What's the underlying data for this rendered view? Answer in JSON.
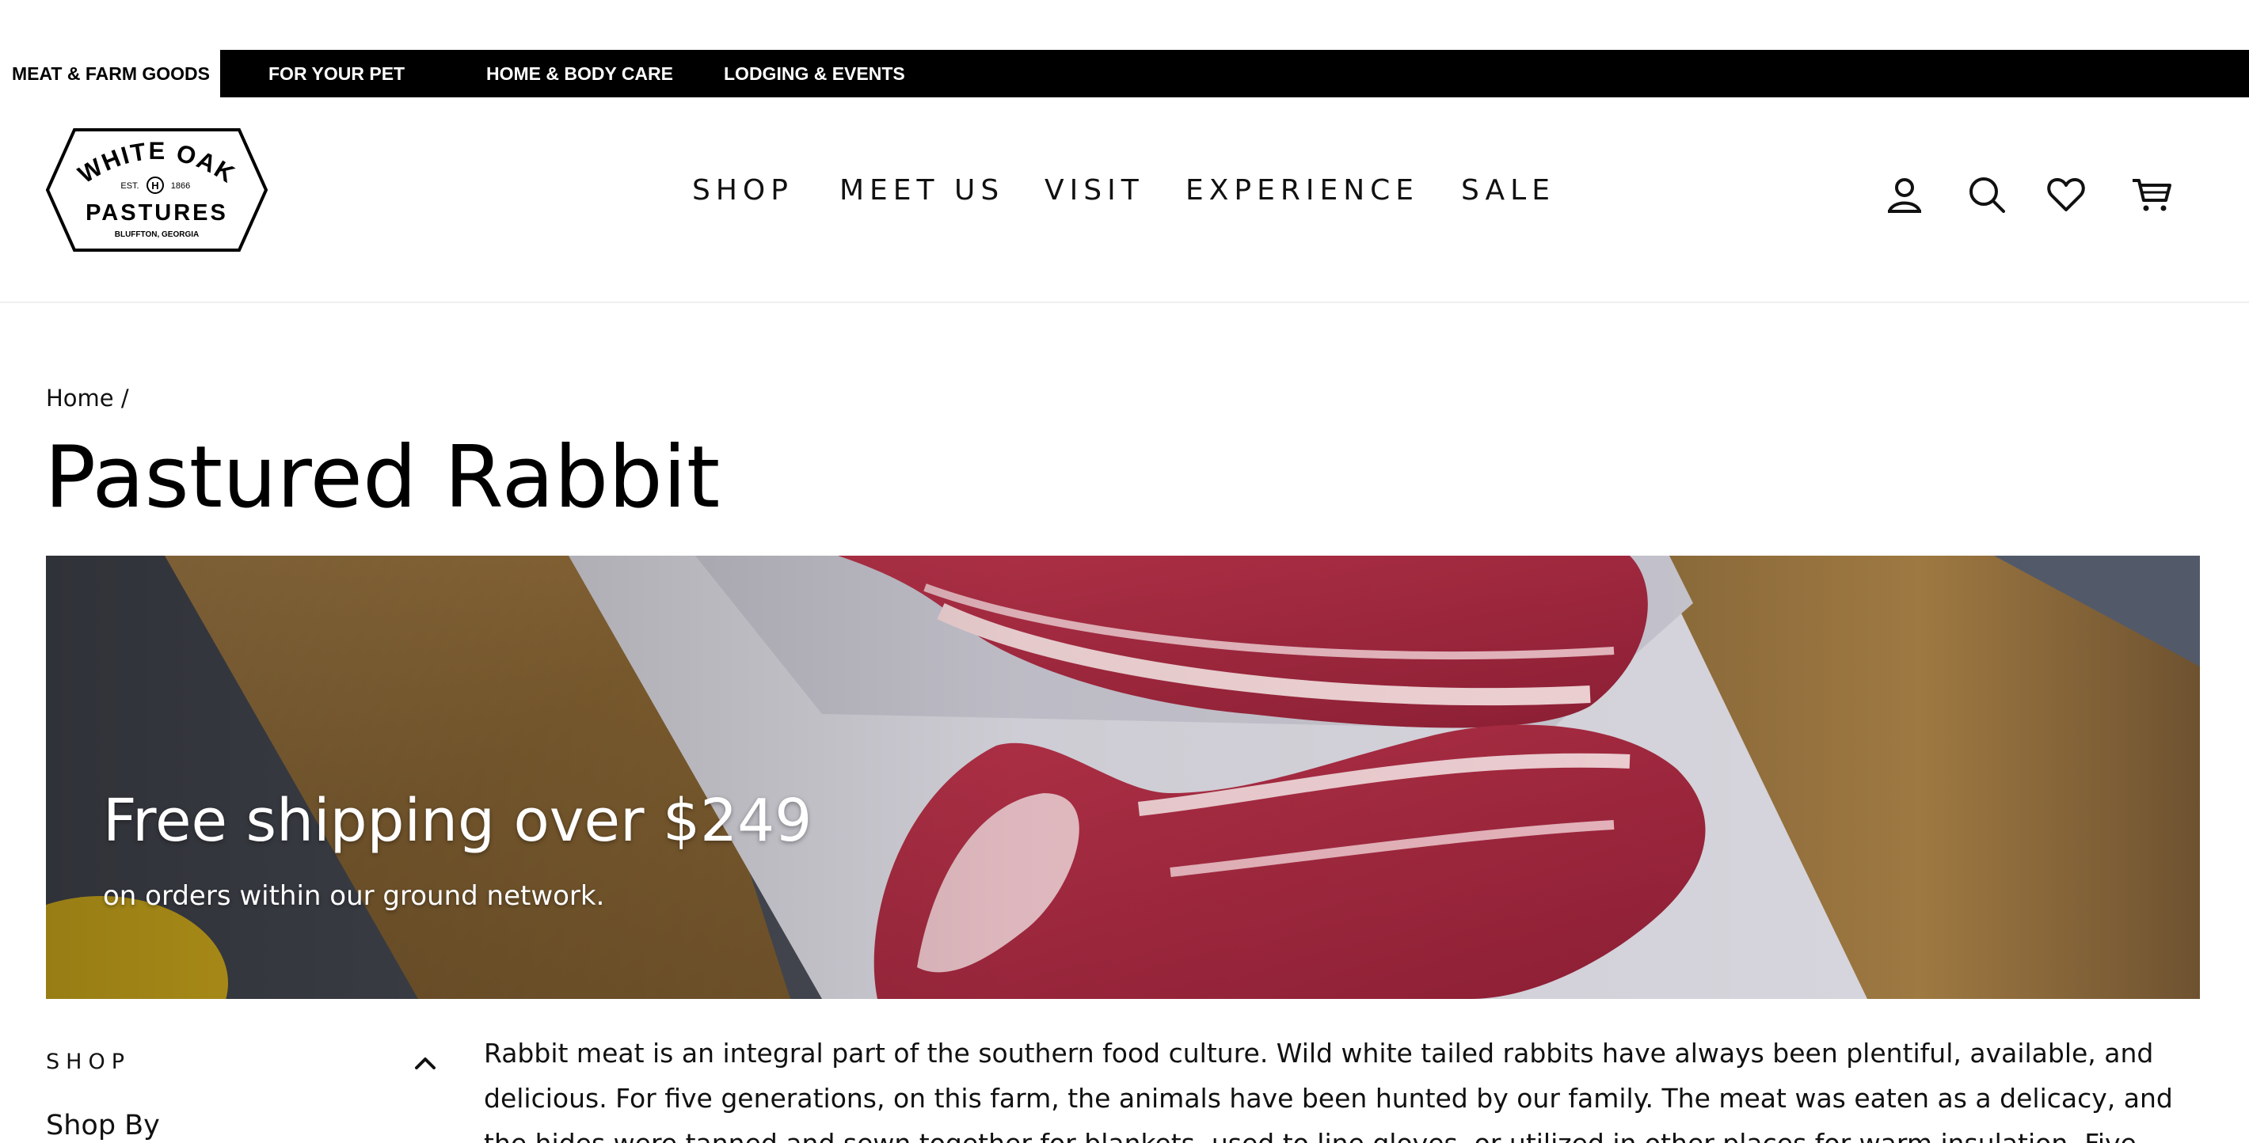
{
  "top_categories": [
    {
      "label": "MEAT & FARM GOODS",
      "active": true
    },
    {
      "label": "FOR YOUR PET",
      "active": false
    },
    {
      "label": "HOME & BODY CARE",
      "active": false
    },
    {
      "label": "LODGING & EVENTS",
      "active": false
    }
  ],
  "logo": {
    "line1": "WHITE OAK",
    "est_left": "EST.",
    "est_right": "1866",
    "monogram": "H",
    "line2": "PASTURES",
    "line3": "BLUFFTON, GEORGIA"
  },
  "nav": [
    {
      "label": "SHOP"
    },
    {
      "label": "MEET US"
    },
    {
      "label": "VISIT"
    },
    {
      "label": "EXPERIENCE"
    },
    {
      "label": "SALE"
    }
  ],
  "header_icons": [
    "account-icon",
    "search-icon",
    "wishlist-heart-icon",
    "cart-icon"
  ],
  "breadcrumb": {
    "home": "Home",
    "separator": "/"
  },
  "page_title": "Pastured Rabbit",
  "banner": {
    "heading": "Free shipping over $249",
    "subheading": "on orders within our ground network."
  },
  "sidebar": {
    "section_label": "SHOP",
    "sub_label": "Shop By"
  },
  "description": "Rabbit meat is an integral part of the southern food culture. Wild white tailed rabbits have always been plentiful, available, and delicious. For five generations, on this farm, the animals have been hunted by our family. The meat was eaten as a delicacy, and the hides were tanned and sewn together for blankets, used to line gloves, or utilized in other places for warm insulation. Five"
}
